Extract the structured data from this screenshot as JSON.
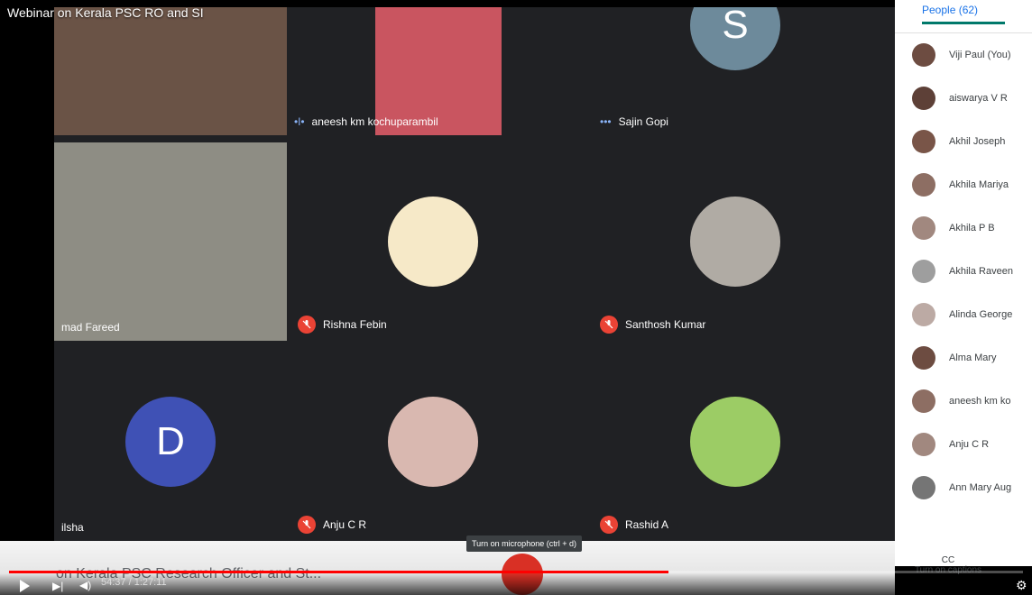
{
  "video_title": "Webinar on Kerala PSC RO and SI",
  "meet_caption": "on Kerala PSC Research Officer and St...",
  "tiles": [
    {
      "name": "",
      "mic": "none"
    },
    {
      "name": "aneesh km kochuparambil",
      "mic": "speaking"
    },
    {
      "name": "Sajin Gopi",
      "mic": "speaking",
      "letter": "S"
    },
    {
      "name": "mad Fareed",
      "mic": "none"
    },
    {
      "name": "Rishna Febin",
      "mic": "off"
    },
    {
      "name": "Santhosh Kumar",
      "mic": "off"
    },
    {
      "name": "ilsha",
      "mic": "none",
      "letter": "D"
    },
    {
      "name": "Anju C R",
      "mic": "off"
    },
    {
      "name": "Rashid A",
      "mic": "off"
    }
  ],
  "people_panel": {
    "tab_label": "People (62)",
    "participants": [
      "Viji Paul (You)",
      "aiswarya V R",
      "Akhil Joseph",
      "Akhila Mariya",
      "Akhila P B",
      "Akhila Raveen",
      "Alinda George",
      "Alma Mary",
      "aneesh km ko",
      "Anju C R",
      "Ann Mary Aug"
    ]
  },
  "tooltip": "Turn on microphone (ctrl + d)",
  "captions_label": "Turn on captions",
  "time_display": "54:37 / 1:27:11",
  "progress": 0.65,
  "colors": {
    "red": "#ea4335",
    "teal": "#00796b",
    "blue": "#1a73e8"
  }
}
